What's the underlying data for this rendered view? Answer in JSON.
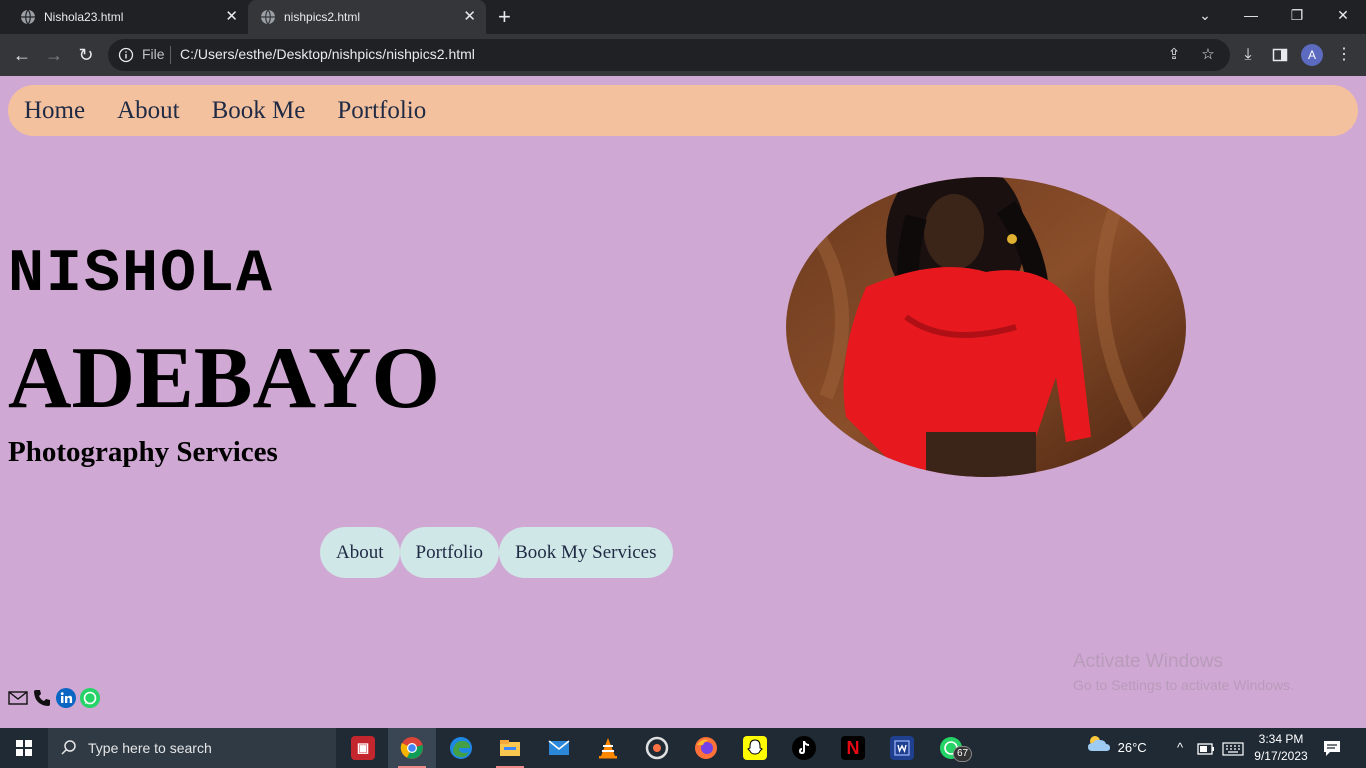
{
  "browser": {
    "tabs": [
      {
        "title": "Nishola23.html",
        "active": false
      },
      {
        "title": "nishpics2.html",
        "active": true
      }
    ],
    "omnibox": {
      "scheme_label": "File",
      "url": "C:/Users/esthe/Desktop/nishpics/nishpics2.html"
    },
    "profile_initial": "A"
  },
  "page": {
    "nav": [
      "Home",
      "About",
      "Book Me",
      "Portfolio"
    ],
    "name_first": "NISHOLA",
    "name_last": "ADEBAYO",
    "tagline": "Photography Services",
    "buttons": [
      "About",
      "Portfolio",
      "Book My Services"
    ],
    "social_icons": [
      "mail-icon",
      "phone-icon",
      "linkedin-icon",
      "whatsapp-icon"
    ],
    "colors": {
      "background": "#d0a8d4",
      "nav_bg": "#f4c19e",
      "button_bg": "#cfe7e6",
      "text_dark": "#1f2a44"
    }
  },
  "watermark": {
    "line1": "Activate Windows",
    "line2": "Go to Settings to activate Windows."
  },
  "taskbar": {
    "search_placeholder": "Type here to search",
    "apps": [
      "pdf-app",
      "chrome",
      "edge",
      "file-explorer",
      "mail",
      "vlc",
      "media-app",
      "firefox",
      "snapchat",
      "tiktok",
      "netflix",
      "word-app",
      "whatsapp"
    ],
    "whatsapp_badge": "67",
    "weather": "26°C",
    "time": "3:34 PM",
    "date": "9/17/2023"
  }
}
